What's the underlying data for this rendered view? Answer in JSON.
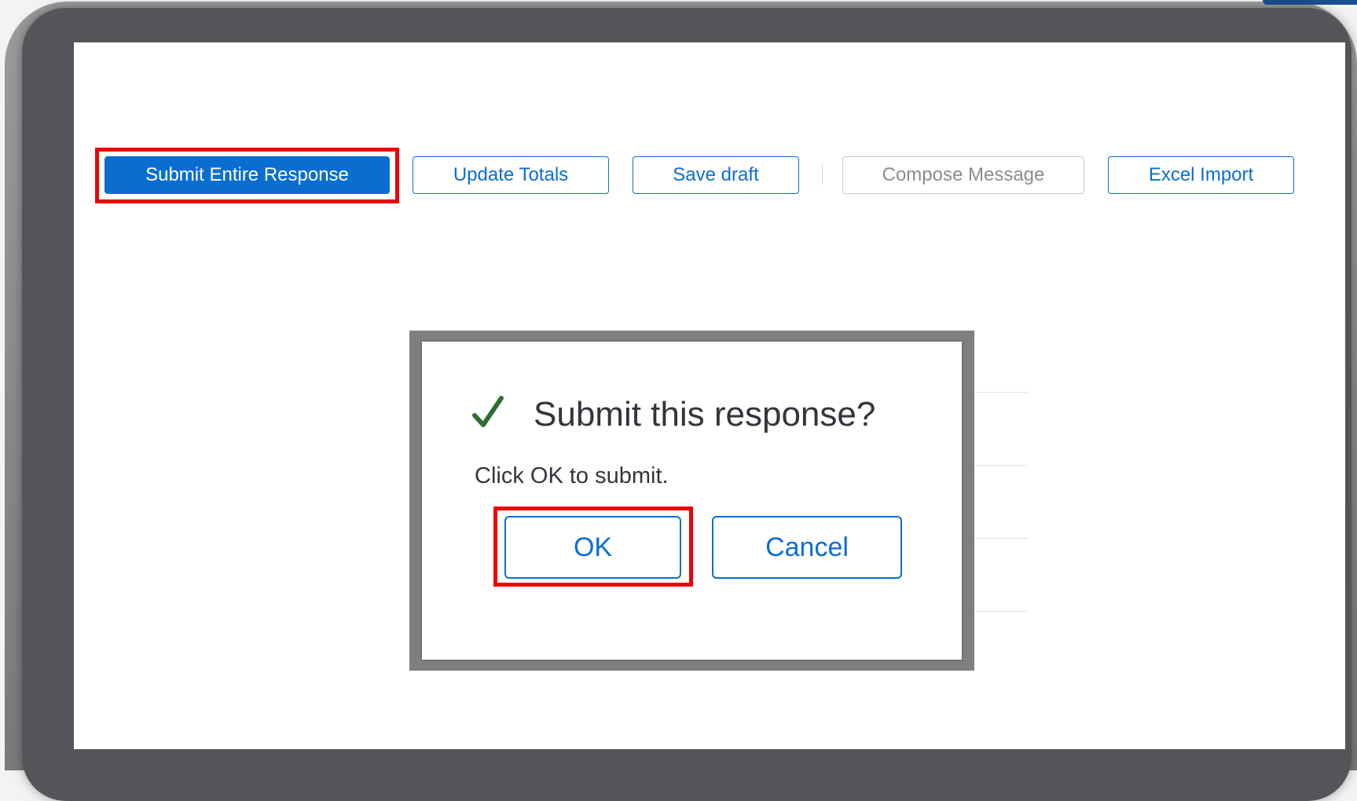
{
  "toolbar": {
    "submit_label": "Submit Entire Response",
    "update_totals_label": "Update Totals",
    "save_draft_label": "Save draft",
    "compose_message_label": "Compose Message",
    "excel_import_label": "Excel Import"
  },
  "dialog": {
    "icon": "checkmark-icon",
    "title": "Submit this response?",
    "message": "Click OK to submit.",
    "ok_label": "OK",
    "cancel_label": "Cancel"
  },
  "colors": {
    "accent": "#0a6ed1",
    "highlight": "#ee0000",
    "success": "#2f6e35",
    "frame": "#545559"
  },
  "states": {
    "compose_message_disabled": true
  }
}
